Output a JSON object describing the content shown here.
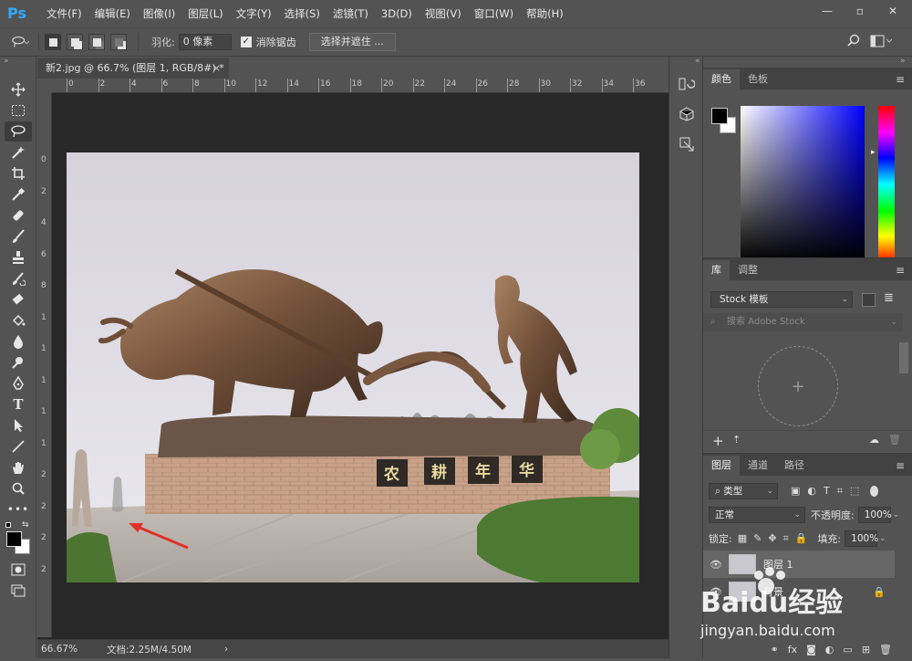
{
  "app": {
    "logo": "Ps",
    "menu": [
      "文件(F)",
      "编辑(E)",
      "图像(I)",
      "图层(L)",
      "文字(Y)",
      "选择(S)",
      "滤镜(T)",
      "3D(D)",
      "视图(V)",
      "窗口(W)",
      "帮助(H)"
    ]
  },
  "options": {
    "feather_label": "羽化:",
    "feather_value": "0 像素",
    "antialias_label": "消除锯齿",
    "select_mask_label": "选择并遮住 ..."
  },
  "document": {
    "tab_title": "新2.jpg @ 66.7% (图层 1, RGB/8#) *",
    "ruler_h": [
      "0",
      "2",
      "4",
      "6",
      "8",
      "10",
      "12",
      "14",
      "16",
      "18",
      "20",
      "22",
      "24",
      "26",
      "28",
      "30",
      "32",
      "34",
      "36"
    ],
    "ruler_v": [
      "0",
      "2",
      "4",
      "6",
      "8",
      "1",
      "1",
      "1",
      "1",
      "1",
      "2",
      "2",
      "2",
      "2"
    ],
    "photo_sign": [
      "农",
      "耕",
      "年",
      "华"
    ]
  },
  "status": {
    "zoom": "66.67%",
    "doc_info": "文档:2.25M/4.50M",
    "arrow": "›"
  },
  "panels": {
    "color_tabs": [
      "颜色",
      "色板"
    ],
    "library_tabs": [
      "库",
      "调整"
    ],
    "library_select": "Stock 模板",
    "library_search_placeholder": "搜索 Adobe Stock",
    "layers_tabs": [
      "图层",
      "通道",
      "路径"
    ],
    "layer_filter": "类型",
    "blend_mode": "正常",
    "opacity_label": "不透明度:",
    "opacity_value": "100%",
    "lock_label": "锁定:",
    "fill_label": "填充:",
    "fill_value": "100%",
    "layers": [
      {
        "name": "图层 1"
      },
      {
        "name": "背景"
      }
    ],
    "footer_icons": [
      "fx"
    ]
  },
  "watermark": {
    "brand": "Baidu经验",
    "url": "jingyan.baidu.com"
  }
}
